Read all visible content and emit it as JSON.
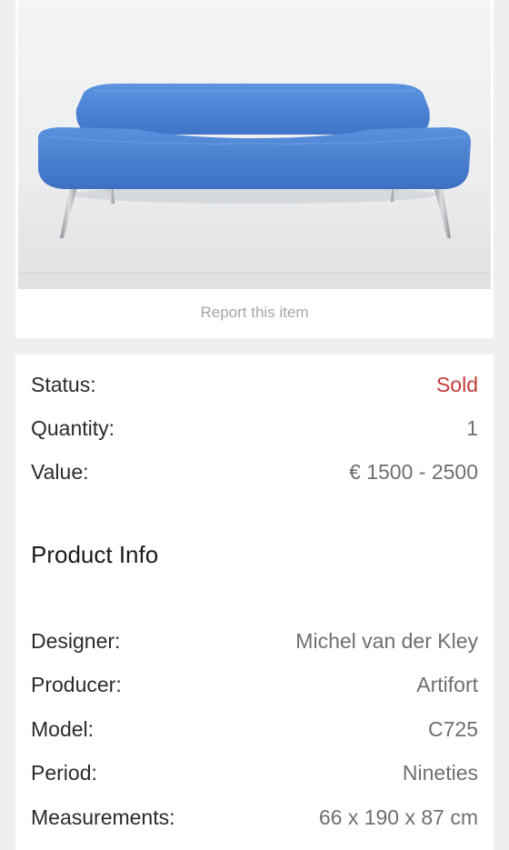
{
  "image": {
    "alt": "Blue sofa on metal legs",
    "colors": {
      "upholstery": "#4f86d8",
      "legs": "#b9bcc0",
      "backdrop": "#eceef0"
    }
  },
  "report_label": "Report this item",
  "status": {
    "status_label": "Status:",
    "status_value": "Sold",
    "status_color": "#c23a3a",
    "quantity_label": "Quantity:",
    "quantity_value": "1",
    "value_label": "Value:",
    "value_value": "€ 1500 - 2500"
  },
  "product_info": {
    "title": "Product Info",
    "rows": [
      {
        "label": "Designer:",
        "value": "Michel van der Kley"
      },
      {
        "label": "Producer:",
        "value": "Artifort"
      },
      {
        "label": "Model:",
        "value": "C725"
      },
      {
        "label": "Period:",
        "value": "Nineties"
      },
      {
        "label": "Measurements:",
        "value": "66 x 190 x 87 cm"
      }
    ]
  }
}
